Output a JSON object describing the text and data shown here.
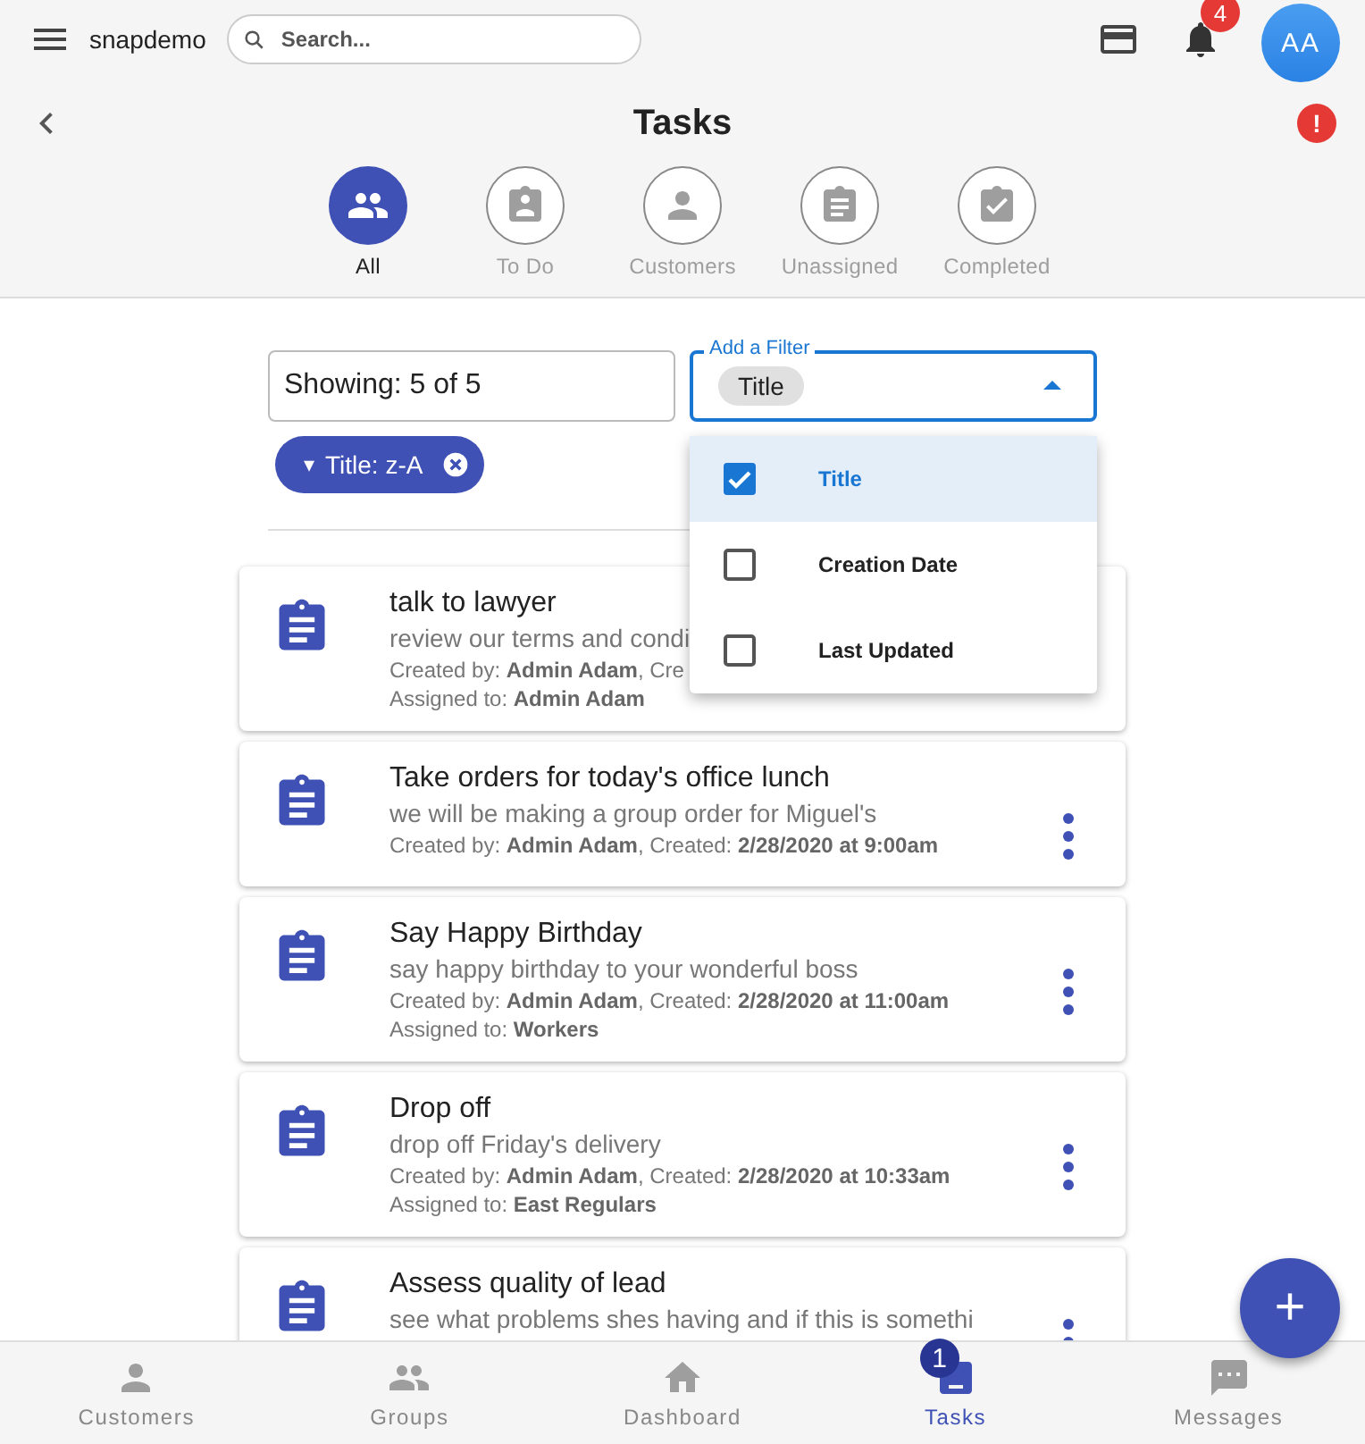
{
  "app_bar": {
    "brand": "snapdemo",
    "search": {
      "placeholder": "Search..."
    },
    "notification_count": "4",
    "avatar": "AA"
  },
  "page": {
    "title": "Tasks",
    "alert": "!"
  },
  "tabs": [
    {
      "label": "All",
      "kind": "group",
      "selected": true
    },
    {
      "label": "To Do",
      "kind": "badge",
      "selected": false
    },
    {
      "label": "Customers",
      "kind": "person",
      "selected": false
    },
    {
      "label": "Unassigned",
      "kind": "list",
      "selected": false
    },
    {
      "label": "Completed",
      "kind": "check",
      "selected": false
    }
  ],
  "showing": {
    "value": "Showing: 5 of 5"
  },
  "filter": {
    "label": "Add a Filter",
    "chip": "Title",
    "expanded": true,
    "options": [
      {
        "label": "Title",
        "checked": true,
        "selected": true
      },
      {
        "label": "Creation Date",
        "checked": false,
        "selected": false
      },
      {
        "label": "Last Updated",
        "checked": false,
        "selected": false
      }
    ]
  },
  "sort_chip": {
    "caret": "▾",
    "label": "Title: z-A"
  },
  "tasks": [
    {
      "title": "talk to lawyer",
      "description": "review our terms and condi",
      "meta": [
        "Created by: **Admin Adam**, Cre",
        "Assigned to: **Admin Adam**"
      ],
      "menu": false
    },
    {
      "title": "Take orders for today's office lunch",
      "description": "we will be making a group order for Miguel's",
      "meta": [
        "Created by: **Admin Adam**, Created: **2/28/2020 at 9:00am**"
      ],
      "menu": true
    },
    {
      "title": "Say Happy Birthday",
      "description": "say happy birthday to your wonderful boss",
      "meta": [
        "Created by: **Admin Adam**, Created: **2/28/2020 at 11:00am**",
        "Assigned to: **Workers**"
      ],
      "menu": true
    },
    {
      "title": "Drop off",
      "description": "drop off Friday's delivery",
      "meta": [
        "Created by: **Admin Adam**, Created: **2/28/2020 at 10:33am**",
        "Assigned to: **East Regulars**"
      ],
      "menu": true
    },
    {
      "title": "Assess quality of lead",
      "description": "see what problems shes having and if this is somethi",
      "menu": true
    }
  ],
  "fab": "+",
  "bottom_nav": [
    {
      "label": "Customers",
      "kind": "person",
      "selected": false
    },
    {
      "label": "Groups",
      "kind": "group",
      "selected": false
    },
    {
      "label": "Dashboard",
      "kind": "home",
      "selected": false
    },
    {
      "label": "Tasks",
      "kind": "task",
      "selected": true,
      "badge": "1"
    },
    {
      "label": "Messages",
      "kind": "chat",
      "selected": false
    }
  ]
}
